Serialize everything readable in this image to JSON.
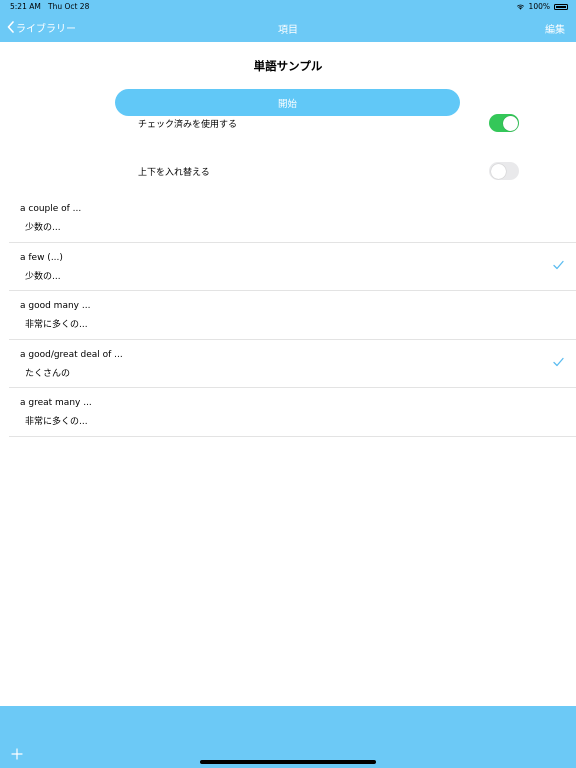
{
  "status_bar": {
    "time": "5:21 AM",
    "date": "Thu Oct 28",
    "battery": "100%"
  },
  "nav": {
    "back_label": "ライブラリー",
    "title": "項目",
    "edit_label": "編集"
  },
  "page": {
    "title": "単語サンプル",
    "start_label": "開始"
  },
  "options": [
    {
      "label": "チェック済みを使用する",
      "enabled": true
    },
    {
      "label": "上下を入れ替える",
      "enabled": false
    }
  ],
  "items": [
    {
      "term": "a couple of ...",
      "meaning": "少数の...",
      "checked": false
    },
    {
      "term": "a few (...)",
      "meaning": "少数の...",
      "checked": true
    },
    {
      "term": "a good many ...",
      "meaning": "非常に多くの...",
      "checked": false
    },
    {
      "term": "a good/great deal of ...",
      "meaning": "たくさんの",
      "checked": true
    },
    {
      "term": "a great many ...",
      "meaning": "非常に多くの...",
      "checked": false
    }
  ],
  "colors": {
    "accent": "#6cc9f6",
    "button": "#61c8f7",
    "toggle_on": "#34c759",
    "check": "#5bbcf0"
  },
  "icons": {
    "back": "chevron-left-icon",
    "check": "checkmark-icon",
    "add": "plus-icon",
    "wifi": "wifi-icon",
    "battery": "battery-icon"
  }
}
